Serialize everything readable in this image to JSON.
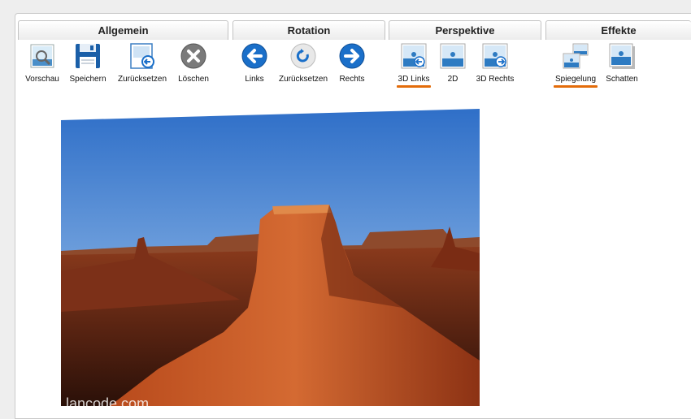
{
  "groups": [
    {
      "title": "Allgemein"
    },
    {
      "title": "Rotation"
    },
    {
      "title": "Perspektive"
    },
    {
      "title": "Effekte"
    }
  ],
  "tools": {
    "preview": "Vorschau",
    "save": "Speichern",
    "reset_general": "Zurücksetzen",
    "delete": "Löschen",
    "rotate_left": "Links",
    "rotate_reset": "Zurücksetzen",
    "rotate_right": "Rechts",
    "persp_3d_left": "3D Links",
    "persp_2d": "2D",
    "persp_3d_right": "3D Rechts",
    "reflection": "Spiegelung",
    "shadow": "Schatten"
  },
  "active": {
    "perspective": "3D Links",
    "effect": "Spiegelung"
  },
  "image": {
    "watermark": "lancode.com"
  },
  "colors": {
    "accent": "#e36c0a",
    "rotate_blue": "#1a6fc9",
    "delete_gray": "#7a7a7a"
  },
  "icons": [
    "magnifier-icon",
    "floppy-disk-icon",
    "reset-image-icon",
    "delete-circle-icon",
    "arrow-left-circle-icon",
    "rotate-reset-icon",
    "arrow-right-circle-icon",
    "perspective-3d-left-icon",
    "perspective-2d-icon",
    "perspective-3d-right-icon",
    "reflection-icon",
    "shadow-icon"
  ]
}
